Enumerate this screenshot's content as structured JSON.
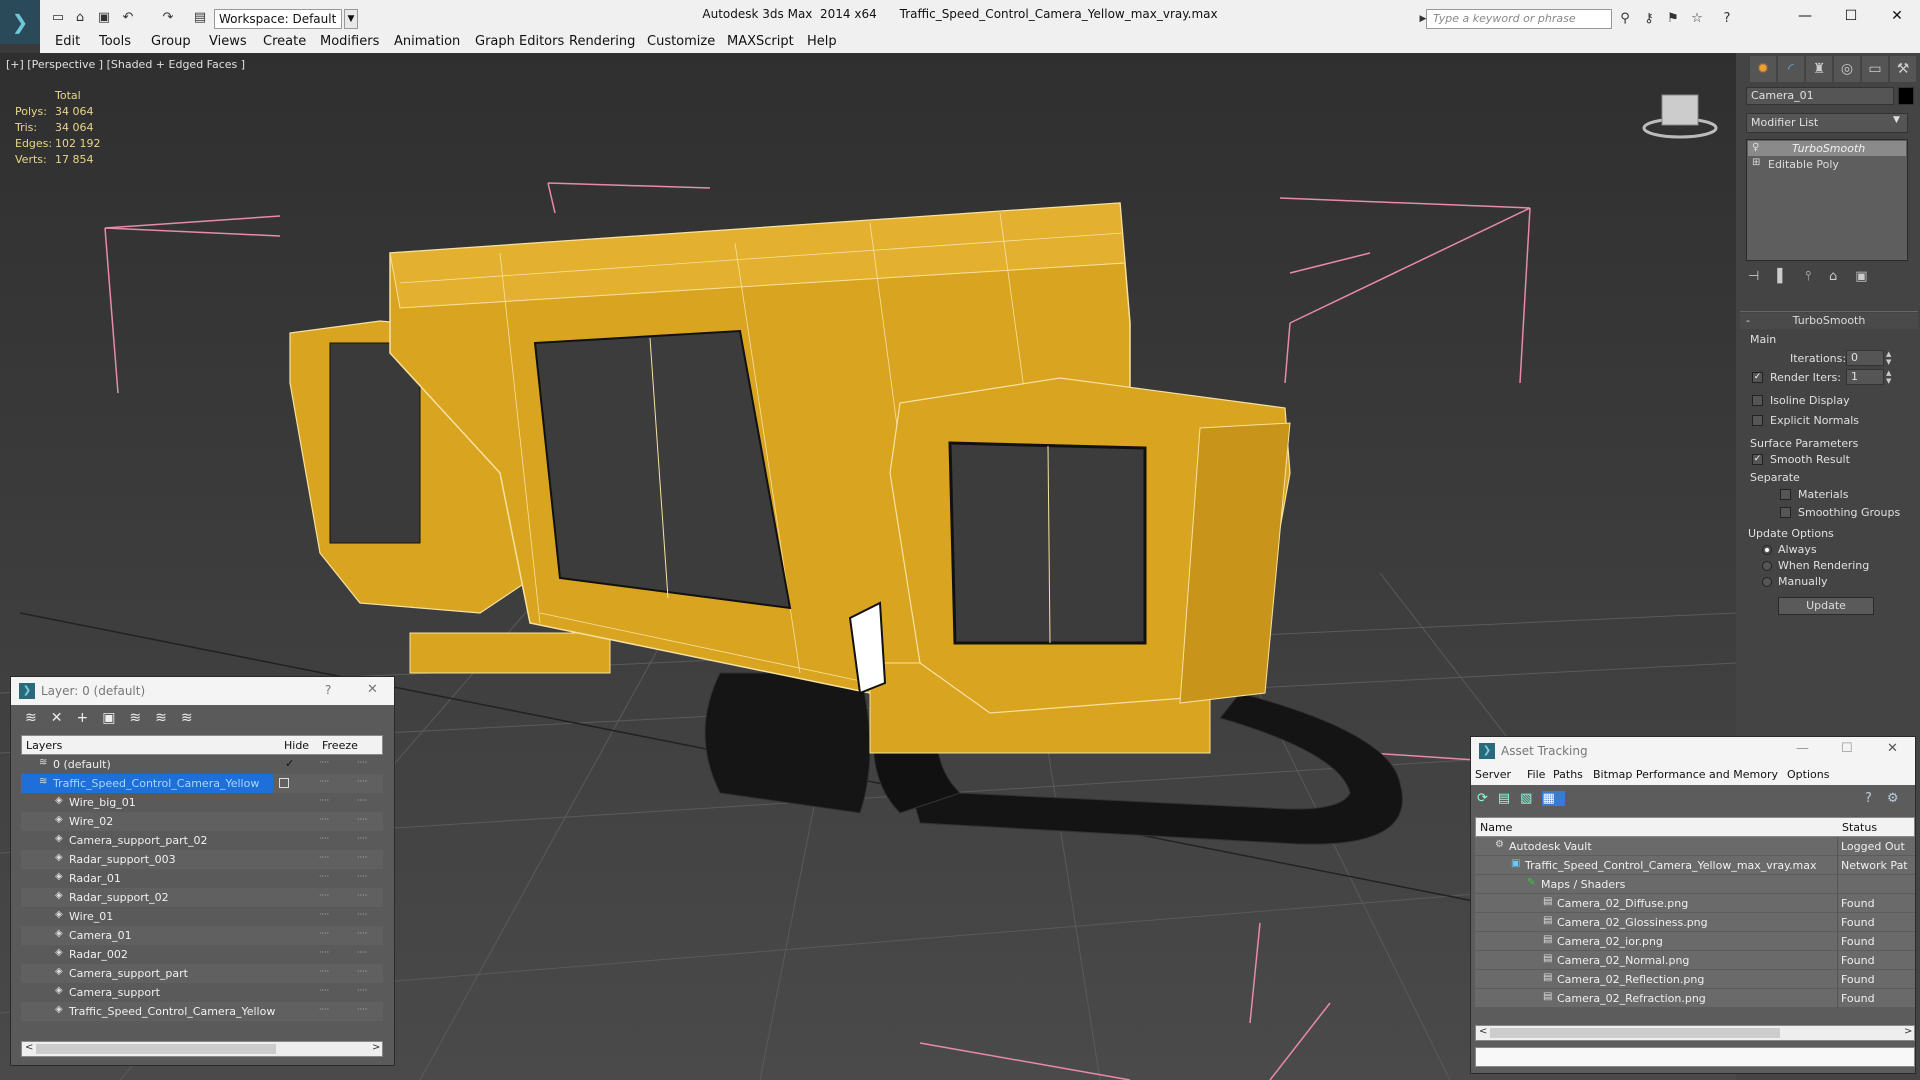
{
  "titlebar": {
    "app_name": "Autodesk 3ds Max  2014 x64",
    "file_name": "Traffic_Speed_Control_Camera_Yellow_max_vray.max",
    "workspace": "Workspace: Default",
    "search_placeholder": "Type a keyword or phrase"
  },
  "menu": [
    "Edit",
    "Tools",
    "Group",
    "Views",
    "Create",
    "Modifiers",
    "Animation",
    "Graph Editors",
    "Rendering",
    "Customize",
    "MAXScript",
    "Help"
  ],
  "viewport": {
    "label": "[+] [Perspective ] [Shaded + Edged Faces ]",
    "stats": {
      "header": "Total",
      "rows": [
        {
          "label": "Polys:",
          "value": "34 064"
        },
        {
          "label": "Tris:",
          "value": "34 064"
        },
        {
          "label": "Edges:",
          "value": "102 192"
        },
        {
          "label": "Verts:",
          "value": "17 854"
        }
      ]
    }
  },
  "command_panel": {
    "object_name": "Camera_01",
    "modifier_list": "Modifier List",
    "stack": [
      {
        "label": "TurboSmooth",
        "selected": true
      },
      {
        "label": "Editable Poly",
        "selected": false
      }
    ],
    "rollout_title": "TurboSmooth",
    "main_label": "Main",
    "iterations_label": "Iterations:",
    "iterations_value": "0",
    "render_iters_label": "Render Iters:",
    "render_iters_value": "1",
    "render_iters_checked": true,
    "isoline_label": "Isoline Display",
    "explicit_normals_label": "Explicit Normals",
    "surface_params_label": "Surface Parameters",
    "smooth_result_label": "Smooth Result",
    "smooth_result_checked": true,
    "separate_label": "Separate",
    "materials_label": "Materials",
    "smoothing_groups_label": "Smoothing Groups",
    "update_options_label": "Update Options",
    "update_always": "Always",
    "update_when_rendering": "When Rendering",
    "update_manually": "Manually",
    "update_button": "Update"
  },
  "layer_panel": {
    "title": "Layer: 0 (default)",
    "help": "?",
    "col_layers": "Layers",
    "col_hide": "Hide",
    "col_freeze": "Freeze",
    "rows": [
      {
        "name": "0 (default)",
        "level": 0,
        "selected": false,
        "checked": true
      },
      {
        "name": "Traffic_Speed_Control_Camera_Yellow",
        "level": 0,
        "selected": true,
        "checked": false
      },
      {
        "name": "Wire_big_01",
        "level": 1,
        "selected": false,
        "checked": false
      },
      {
        "name": "Wire_02",
        "level": 1,
        "selected": false,
        "checked": false
      },
      {
        "name": "Camera_support_part_02",
        "level": 1,
        "selected": false,
        "checked": false
      },
      {
        "name": "Radar_support_003",
        "level": 1,
        "selected": false,
        "checked": false
      },
      {
        "name": "Radar_01",
        "level": 1,
        "selected": false,
        "checked": false
      },
      {
        "name": "Radar_support_02",
        "level": 1,
        "selected": false,
        "checked": false
      },
      {
        "name": "Wire_01",
        "level": 1,
        "selected": false,
        "checked": false
      },
      {
        "name": "Camera_01",
        "level": 1,
        "selected": false,
        "checked": false
      },
      {
        "name": "Radar_002",
        "level": 1,
        "selected": false,
        "checked": false
      },
      {
        "name": "Camera_support_part",
        "level": 1,
        "selected": false,
        "checked": false
      },
      {
        "name": "Camera_support",
        "level": 1,
        "selected": false,
        "checked": false
      },
      {
        "name": "Traffic_Speed_Control_Camera_Yellow",
        "level": 1,
        "selected": false,
        "checked": false
      }
    ]
  },
  "asset_panel": {
    "title": "Asset Tracking",
    "menu": [
      "Server",
      "File",
      "Paths",
      "Bitmap Performance and Memory",
      "Options"
    ],
    "col_name": "Name",
    "col_status": "Status",
    "rows": [
      {
        "name": "Autodesk Vault",
        "level": 1,
        "status": "Logged Out"
      },
      {
        "name": "Traffic_Speed_Control_Camera_Yellow_max_vray.max",
        "level": 2,
        "status": "Network Pat"
      },
      {
        "name": "Maps / Shaders",
        "level": 3,
        "status": ""
      },
      {
        "name": "Camera_02_Diffuse.png",
        "level": 4,
        "status": "Found"
      },
      {
        "name": "Camera_02_Glossiness.png",
        "level": 4,
        "status": "Found"
      },
      {
        "name": "Camera_02_ior.png",
        "level": 4,
        "status": "Found"
      },
      {
        "name": "Camera_02_Normal.png",
        "level": 4,
        "status": "Found"
      },
      {
        "name": "Camera_02_Reflection.png",
        "level": 4,
        "status": "Found"
      },
      {
        "name": "Camera_02_Refraction.png",
        "level": 4,
        "status": "Found"
      }
    ]
  },
  "colors": {
    "model_yellow": "#d9a420",
    "selection_blue": "#1e6fd9",
    "grid": "#555555",
    "bbox_pink": "#e88aa8"
  }
}
